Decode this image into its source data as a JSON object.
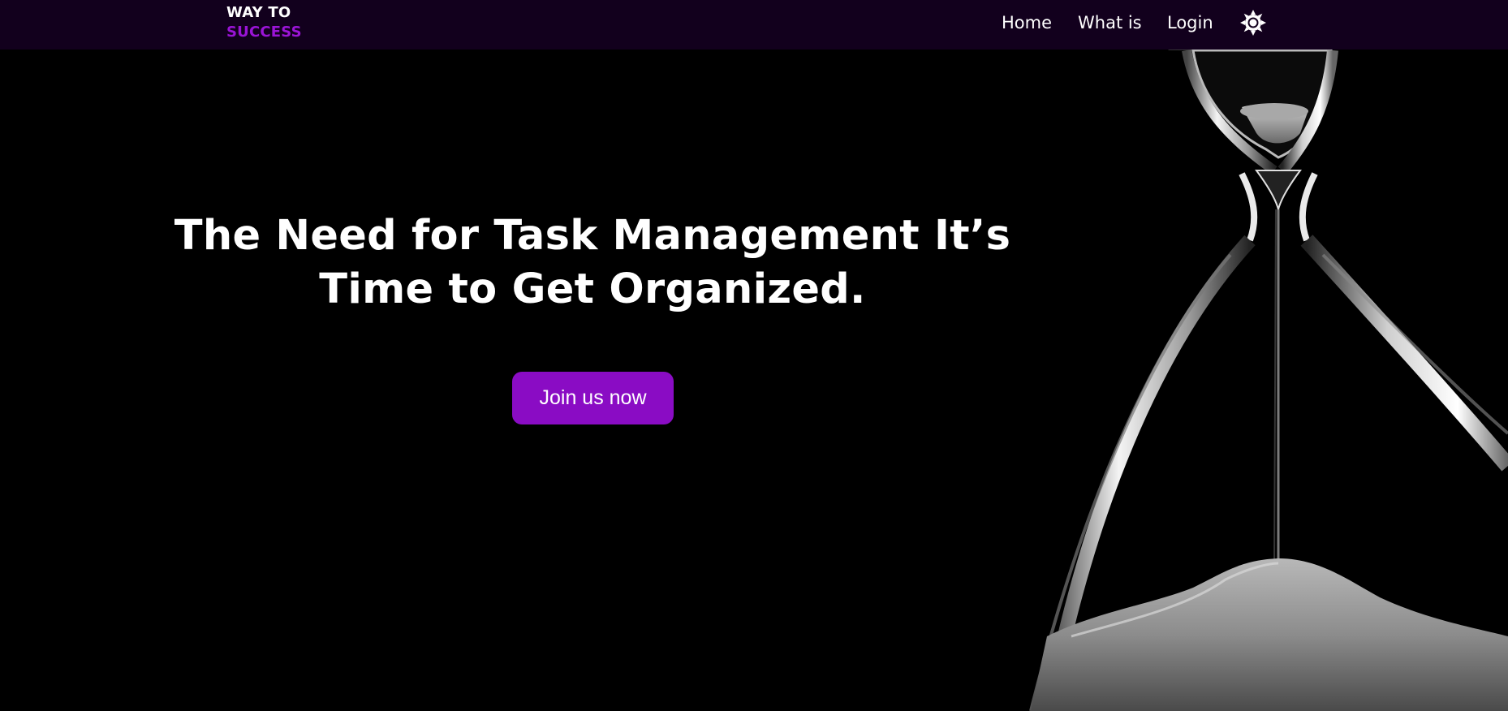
{
  "brand": {
    "line1": "WAY TO",
    "line2": "SUCCESS",
    "accent_color": "#9a14d6"
  },
  "nav": {
    "links": [
      {
        "label": "Home"
      },
      {
        "label": "What is"
      },
      {
        "label": "Login"
      }
    ],
    "theme_toggle_icon": "sun-icon"
  },
  "hero": {
    "title": "The Need for Task Management It’s Time to Get Organized.",
    "cta_label": "Join us now",
    "cta_color": "#8a0cc4"
  },
  "colors": {
    "navbar_bg": "#12001d",
    "page_bg": "#000000"
  },
  "decor": {
    "background_image": "hourglass-image"
  }
}
